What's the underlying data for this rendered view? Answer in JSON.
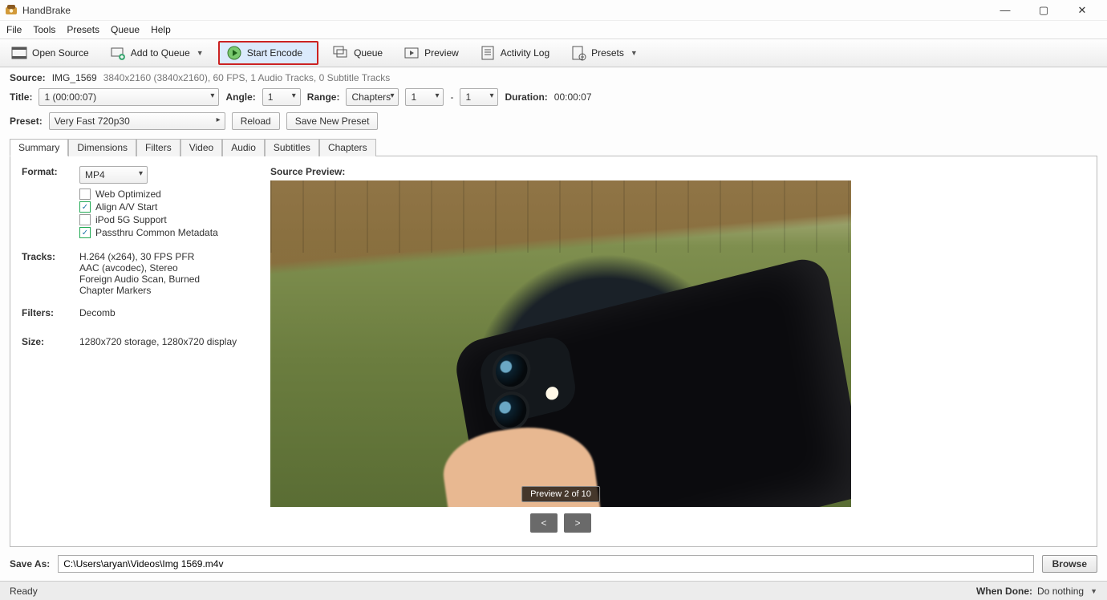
{
  "window": {
    "title": "HandBrake"
  },
  "menu": [
    "File",
    "Tools",
    "Presets",
    "Queue",
    "Help"
  ],
  "toolbar": {
    "open_source": "Open Source",
    "add_to_queue": "Add to Queue",
    "start_encode": "Start Encode",
    "queue": "Queue",
    "preview": "Preview",
    "activity_log": "Activity Log",
    "presets": "Presets"
  },
  "source": {
    "label": "Source:",
    "name": "IMG_1569",
    "meta": "3840x2160 (3840x2160), 60 FPS, 1 Audio Tracks, 0 Subtitle Tracks"
  },
  "title_row": {
    "title_label": "Title:",
    "title_value": "1  (00:00:07)",
    "angle_label": "Angle:",
    "angle_value": "1",
    "range_label": "Range:",
    "range_type": "Chapters",
    "range_from": "1",
    "range_sep": "-",
    "range_to": "1",
    "duration_label": "Duration:",
    "duration_value": "00:00:07"
  },
  "preset_row": {
    "label": "Preset:",
    "value": "Very Fast 720p30",
    "reload": "Reload",
    "save_new": "Save New Preset"
  },
  "tabs": [
    "Summary",
    "Dimensions",
    "Filters",
    "Video",
    "Audio",
    "Subtitles",
    "Chapters"
  ],
  "active_tab": "Summary",
  "summary": {
    "format_label": "Format:",
    "format_value": "MP4",
    "checks": {
      "web_optimized": {
        "label": "Web Optimized",
        "checked": false
      },
      "align_av": {
        "label": "Align A/V Start",
        "checked": true
      },
      "ipod_5g": {
        "label": "iPod 5G Support",
        "checked": false
      },
      "passthru": {
        "label": "Passthru Common Metadata",
        "checked": true
      }
    },
    "tracks_label": "Tracks:",
    "tracks_lines": [
      "H.264 (x264), 30 FPS PFR",
      "AAC (avcodec), Stereo",
      "Foreign Audio Scan, Burned",
      "Chapter Markers"
    ],
    "filters_label": "Filters:",
    "filters_value": "Decomb",
    "size_label": "Size:",
    "size_value": "1280x720 storage, 1280x720 display",
    "source_preview_label": "Source Preview:",
    "preview_badge": "Preview 2 of 10",
    "prev_arrow": "<",
    "next_arrow": ">"
  },
  "save": {
    "label": "Save As:",
    "path": "C:\\Users\\aryan\\Videos\\Img 1569.m4v",
    "browse": "Browse"
  },
  "status": {
    "left": "Ready",
    "when_done_label": "When Done:",
    "when_done_value": "Do nothing"
  }
}
